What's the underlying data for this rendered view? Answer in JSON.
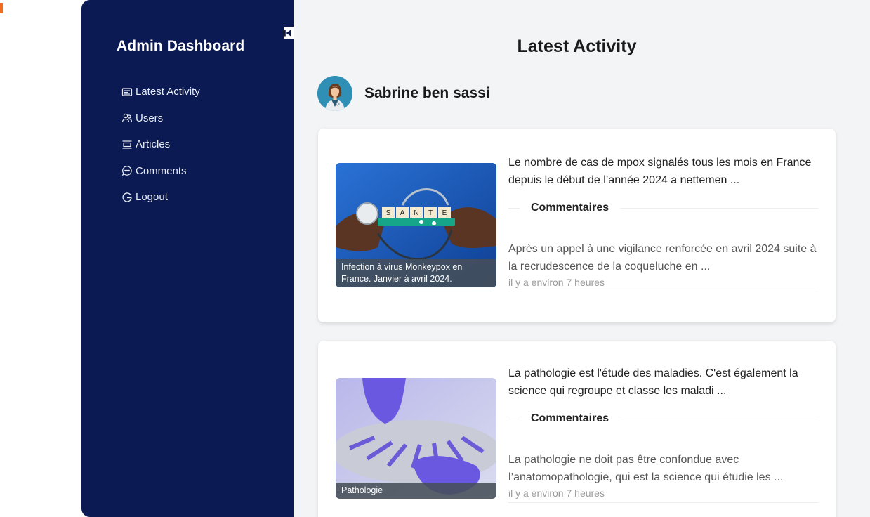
{
  "sidebar": {
    "title": "Admin Dashboard",
    "items": [
      {
        "label": "Latest Activity",
        "icon": "activity-icon"
      },
      {
        "label": "Users",
        "icon": "users-icon"
      },
      {
        "label": "Articles",
        "icon": "articles-icon"
      },
      {
        "label": "Comments",
        "icon": "comments-icon"
      },
      {
        "label": "Logout",
        "icon": "logout-icon"
      }
    ],
    "background": "#0b1a52"
  },
  "main": {
    "title": "Latest Activity",
    "user": {
      "name": "Sabrine ben sassi"
    },
    "cards": [
      {
        "image_caption": "Infection à virus Monkeypox en France. Janvier à avril 2024.",
        "excerpt": "Le nombre de cas de mpox signalés tous les mois en France depuis le début de l’année 2024 a nettemen ...",
        "comments_label": "Commentaires",
        "comment": "Après un appel à une vigilance renforcée en avril 2024 suite à la recrudescence de la coqueluche en ...",
        "time": "il y a environ 7 heures"
      },
      {
        "image_caption": "Pathologie",
        "excerpt": "La pathologie est l'étude des maladies. C'est également la science qui regroupe et classe les maladi ...",
        "comments_label": "Commentaires",
        "comment": "La pathologie ne doit pas être confondue avec l’anatomopathologie, qui est la science qui étudie les ...",
        "time": "il y a environ 7 heures"
      }
    ]
  }
}
